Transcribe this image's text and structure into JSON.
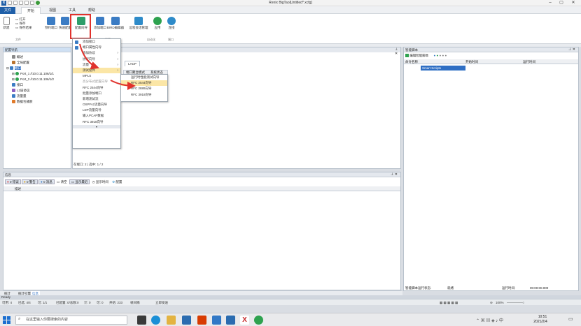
{
  "app": {
    "icon_letter": "X",
    "title": "Renix BigTao[Untitled*.xcfg]"
  },
  "menu_tabs": [
    "文件",
    "开始",
    "视图",
    "工具",
    "帮助"
  ],
  "ribbon": {
    "file_small": [
      "新建",
      "打开",
      "保存",
      "保存结果"
    ],
    "buttons": [
      "预约端口",
      "快速配置",
      "配置向导",
      "添加端口",
      "BIRD编辑器",
      "远程会话管理",
      "应用",
      "连接"
    ],
    "group_labels": [
      "文件",
      "配置",
      "自动化",
      "端口"
    ]
  },
  "left_panel": {
    "title": "配置导航",
    "items": [
      "概述",
      "全局配置",
      "端口",
      "Port_1 //10.0.11.106/1/1",
      "Port_2 //10.0.11.106/1/2",
      "接口",
      "L2层协议",
      "流量量",
      "数据包捕获"
    ]
  },
  "dropdown": {
    "items": [
      "添加接口",
      "端口属性向导",
      "添加协议",
      "协议向导",
      "流量",
      "测试套件",
      "MPLS",
      "高分布式配置向导",
      "RFC 2544向导",
      "批量添加端口",
      "新增测试流",
      "OSPFv2流量向导",
      "LDP流量向导",
      "输入PCAP数据",
      "RFC 3918向导"
    ]
  },
  "submenu": {
    "items": [
      "运行时性能测试向导",
      "RFC 2544向导",
      "RFC 2889向导",
      "RFC 3918向导"
    ]
  },
  "center": {
    "tab": "LACP",
    "col1": "端口聚合模式",
    "col2": "系统状态",
    "footer": "在端口: 2 | 选中: 1 / 2"
  },
  "right_panel": {
    "title": "智能脚本",
    "toolbar_label": "编辑智能脚本",
    "columns": [
      "命令名称",
      "开始时间",
      "运行时间"
    ],
    "row": "Smart Scripts",
    "footer_label": "智能脚本运行状态:",
    "footer_status": "就绪",
    "footer_time_label": "运行时间:",
    "footer_time": "00:00:00.000"
  },
  "log_panel": {
    "title": "信息",
    "filters": [
      "0 错误",
      "0 警告",
      "0 消息",
      "清空",
      "显示最近",
      "显示时间",
      "配置"
    ],
    "col": "描述"
  },
  "bottom_tabs": [
    "统计",
    "统计引擎",
    "信息"
  ],
  "ready_text": "Ready",
  "status": [
    "可用: 4",
    "已选: 4/4",
    "可: 1/1",
    "已配置: 0/总数:0",
    "计: 0",
    "可: 0",
    "开始: 233",
    "帧间隔",
    "立即发送"
  ],
  "zoom": "100%",
  "taskbar": {
    "search_placeholder": "在这里输入你要搜索的内容",
    "time": "10:51",
    "date": "2021/2/4"
  }
}
